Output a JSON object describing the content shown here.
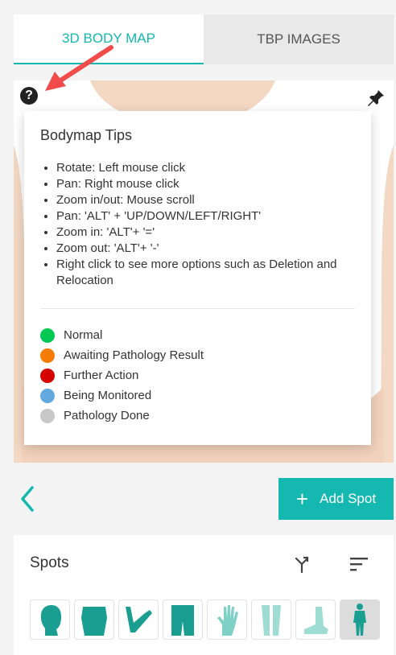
{
  "tabs": [
    {
      "label": "3D BODY MAP",
      "active": true
    },
    {
      "label": "TBP IMAGES",
      "active": false
    }
  ],
  "help_icon": {
    "symbol": "?",
    "icon": "question-circle"
  },
  "pin_icon": "pin-icon",
  "tips": {
    "title": "Bodymap Tips",
    "items": [
      "Rotate: Left mouse click",
      "Pan: Right mouse click",
      "Zoom in/out: Mouse scroll",
      "Pan: 'ALT' + 'UP/DOWN/LEFT/RIGHT'",
      "Zoom in: 'ALT'+ '='",
      "Zoom out: 'ALT'+ '-'",
      "Right click to see more options such as Deletion and Relocation"
    ],
    "legend": [
      {
        "label": "Normal",
        "color": "#00c853"
      },
      {
        "label": "Awaiting Pathology Result",
        "color": "#f57c00"
      },
      {
        "label": "Further Action",
        "color": "#d50000"
      },
      {
        "label": "Being Monitored",
        "color": "#64a8e0"
      },
      {
        "label": "Pathology Done",
        "color": "#c8c8c8"
      }
    ]
  },
  "actions": {
    "back_icon": "chevron-left",
    "add_spot_icon": "+",
    "add_spot_label": "Add Spot"
  },
  "spots": {
    "title": "Spots",
    "merge_icon": "merge-icon",
    "sort_icon": "sort-icon",
    "body_parts": [
      {
        "name": "head",
        "selected": false
      },
      {
        "name": "torso",
        "selected": false
      },
      {
        "name": "arm",
        "selected": false
      },
      {
        "name": "pelvis",
        "selected": false
      },
      {
        "name": "hand",
        "selected": false
      },
      {
        "name": "legs",
        "selected": false
      },
      {
        "name": "foot",
        "selected": false
      },
      {
        "name": "full-body",
        "selected": true
      }
    ]
  },
  "colors": {
    "accent": "#14b8b0",
    "arrow": "#f24b4b",
    "skin": "#f3d8c4"
  }
}
